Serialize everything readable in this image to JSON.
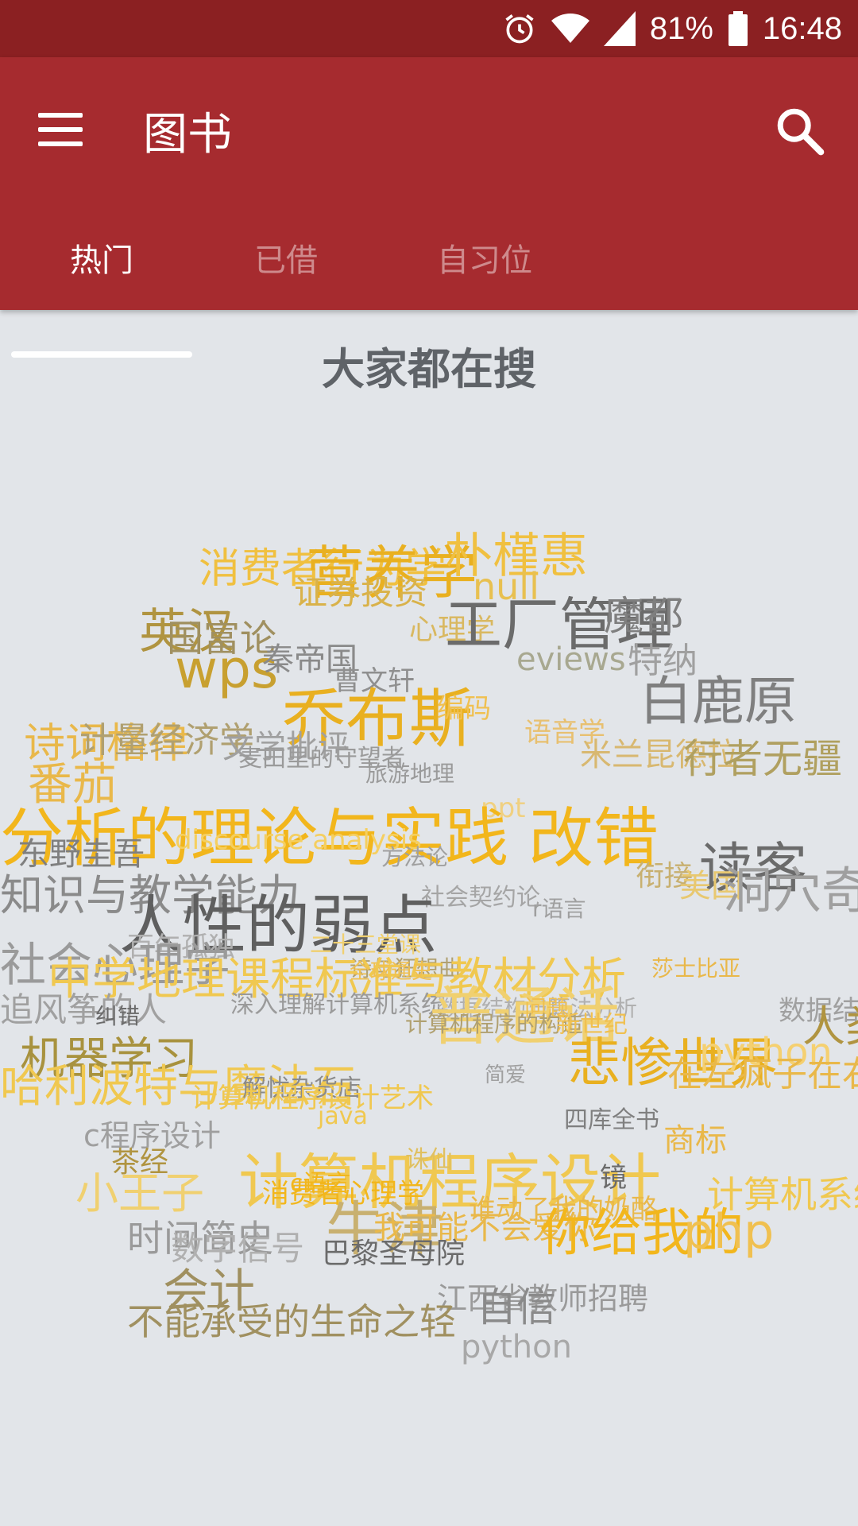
{
  "status": {
    "battery": "81%",
    "time": "16:48",
    "icons": [
      "alarm-icon",
      "wifi-icon",
      "signal-icon",
      "battery-icon"
    ]
  },
  "appbar": {
    "title": "图书",
    "menu_icon": "menu-icon",
    "search_icon": "search-icon"
  },
  "tabs": [
    {
      "label": "热门",
      "active": true
    },
    {
      "label": "已借",
      "active": false
    },
    {
      "label": "自习位",
      "active": false
    }
  ],
  "main": {
    "heading": "大家都在搜"
  },
  "colors": {
    "status_bar": "#8B2022",
    "app_bar": "#A62B2F",
    "background": "#E2E5E9",
    "gold": "#F2B61C",
    "gray": "#6B6B6B",
    "olive": "#A8923E"
  },
  "wordcloud": [
    {
      "text": "消费者行为学",
      "color": "#F0C040"
    },
    {
      "text": "营养学",
      "color": "#E9B020"
    },
    {
      "text": "朴槿惠",
      "color": "#F0C040"
    },
    {
      "text": "证券投资",
      "color": "#D9B24A"
    },
    {
      "text": "null",
      "color": "#E8C050"
    },
    {
      "text": "英汉",
      "color": "#B09440"
    },
    {
      "text": "国富论",
      "color": "#A09060"
    },
    {
      "text": "wps",
      "color": "#C8A030"
    },
    {
      "text": "心理学",
      "color": "#D9B860"
    },
    {
      "text": "工厂管理",
      "color": "#6B6B6B"
    },
    {
      "text": "魔都",
      "color": "#7F7F7F"
    },
    {
      "text": "秦帝国",
      "color": "#8A8A8A"
    },
    {
      "text": "eviews",
      "color": "#A8A890"
    },
    {
      "text": "特纳",
      "color": "#A0A0A0"
    },
    {
      "text": "曹文轩",
      "color": "#8F8F8F"
    },
    {
      "text": "白鹿原",
      "color": "#7F7F7F"
    },
    {
      "text": "乔布斯",
      "color": "#E9B020"
    },
    {
      "text": "编码",
      "color": "#F0C050"
    },
    {
      "text": "诗词格律",
      "color": "#E9B84A"
    },
    {
      "text": "计量经济学",
      "color": "#B0A070"
    },
    {
      "text": "文学批评",
      "color": "#A0A0A0"
    },
    {
      "text": "语音学",
      "color": "#E8C070"
    },
    {
      "text": "米兰昆德拉",
      "color": "#D8B870"
    },
    {
      "text": "行者无疆",
      "color": "#B0A060"
    },
    {
      "text": "麦田里的守望者",
      "color": "#9A9A9A"
    },
    {
      "text": "番茄",
      "color": "#E9B84A"
    },
    {
      "text": "旅游地理",
      "color": "#9A9A9A"
    },
    {
      "text": "ppt",
      "color": "#F0D080"
    },
    {
      "text": "改错",
      "color": "#F2B61C"
    },
    {
      "text": "分析的理论与实践",
      "color": "#F2B61C"
    },
    {
      "text": "discourse analysis",
      "color": "#F5CF60"
    },
    {
      "text": "东野圭吾",
      "color": "#7F7F7F"
    },
    {
      "text": "方法论",
      "color": "#A0A0A0"
    },
    {
      "text": "衔接",
      "color": "#C8B070"
    },
    {
      "text": "读客",
      "color": "#6B6B6B"
    },
    {
      "text": "美国",
      "color": "#E8C870"
    },
    {
      "text": "洞穴奇案",
      "color": "#9F9F9F"
    },
    {
      "text": "社会契约论",
      "color": "#A5A5A5"
    },
    {
      "text": "知识与教学能力",
      "color": "#8A8A8A"
    },
    {
      "text": "r语言",
      "color": "#9F9F9F"
    },
    {
      "text": "人性的弱点",
      "color": "#5F5F5F"
    },
    {
      "text": "百年孤独",
      "color": "#B0B0B0"
    },
    {
      "text": "二十三堂课",
      "color": "#F0D070"
    },
    {
      "text": "社会心理学",
      "color": "#9A9A9A"
    },
    {
      "text": "诗与狂想曲",
      "color": "#B0A070"
    },
    {
      "text": "中学地理课程标准与教材分析",
      "color": "#F0C850"
    },
    {
      "text": "全球通史",
      "color": "#F0C050"
    },
    {
      "text": "莎士比亚",
      "color": "#E9B84A"
    },
    {
      "text": "追风筝的人",
      "color": "#A0A0A0"
    },
    {
      "text": "深入理解计算机系统",
      "color": "#9A9A9A"
    },
    {
      "text": "数据结构与算法分析",
      "color": "#B0B0B0"
    },
    {
      "text": "纠错",
      "color": "#6B6B6B"
    },
    {
      "text": "普通话",
      "color": "#F0D070"
    },
    {
      "text": "问题",
      "color": "#F0C050"
    },
    {
      "text": "数据结构",
      "color": "#A0A0A0"
    },
    {
      "text": "计算机程序的构造",
      "color": "#B0A070"
    },
    {
      "text": "新世纪",
      "color": "#F0C050"
    },
    {
      "text": "人类简史",
      "color": "#B09440"
    },
    {
      "text": "机器学习",
      "color": "#A8923E"
    },
    {
      "text": "悲惨世界",
      "color": "#E9B020"
    },
    {
      "text": "python",
      "color": "#F5D070"
    },
    {
      "text": "简爱",
      "color": "#A0A0A0"
    },
    {
      "text": "在左疯子在右",
      "color": "#E9B84A"
    },
    {
      "text": "哈利波特与魔法石",
      "color": "#F0C850"
    },
    {
      "text": "解忧杂货店",
      "color": "#8A8A8A"
    },
    {
      "text": "计算机程序设计艺术",
      "color": "#F0C850"
    },
    {
      "text": "java",
      "color": "#F0C850"
    },
    {
      "text": "四库全书",
      "color": "#7F7F7F"
    },
    {
      "text": "商标",
      "color": "#E9B84A"
    },
    {
      "text": "c程序设计",
      "color": "#9F9F9F"
    },
    {
      "text": "茶经",
      "color": "#B09440"
    },
    {
      "text": "计算机程序设计",
      "color": "#F0C850"
    },
    {
      "text": "诛仙",
      "color": "#E0C060"
    },
    {
      "text": "镜",
      "color": "#6B6B6B"
    },
    {
      "text": "计算机系统概论",
      "color": "#F0C850"
    },
    {
      "text": "c语言",
      "color": "#F2B61C"
    },
    {
      "text": "小王子",
      "color": "#F0D070"
    },
    {
      "text": "消费者心理学",
      "color": "#F2B61C"
    },
    {
      "text": "牛津",
      "color": "#C8B070"
    },
    {
      "text": "谁动了我的奶酪",
      "color": "#E9B84A"
    },
    {
      "text": "我可能不会爱你",
      "color": "#E9B84A"
    },
    {
      "text": "你给我的",
      "color": "#F2B61C"
    },
    {
      "text": "php",
      "color": "#F0C050"
    },
    {
      "text": "时间简史",
      "color": "#9A9A9A"
    },
    {
      "text": "数字信号",
      "color": "#B0B0B0"
    },
    {
      "text": "巴黎圣母院",
      "color": "#6B6B6B"
    },
    {
      "text": "会计",
      "color": "#A09060"
    },
    {
      "text": "江西省教师招聘",
      "color": "#9A9A9A"
    },
    {
      "text": "不能承受的生命之轻",
      "color": "#A09060"
    },
    {
      "text": "自信",
      "color": "#8A8A8A"
    },
    {
      "text": "python",
      "color": "#A8A8A8"
    }
  ]
}
